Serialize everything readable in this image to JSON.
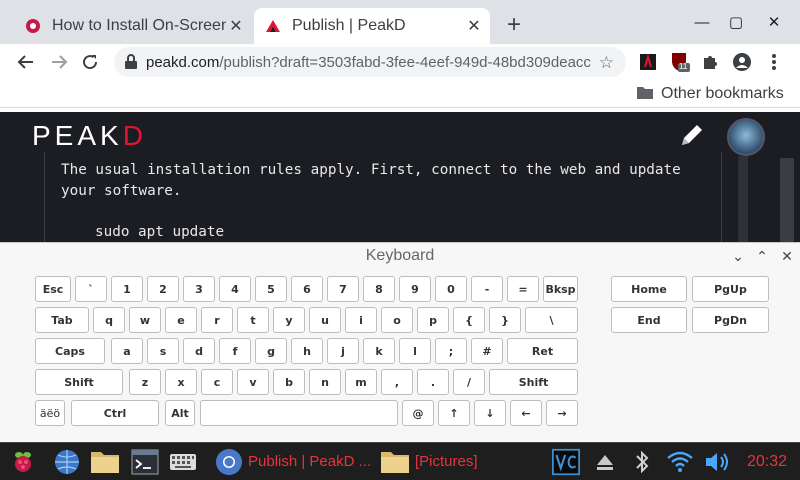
{
  "browser": {
    "tabs": [
      {
        "title": "How to Install On-Screen Keyboard",
        "active": false
      },
      {
        "title": "Publish | PeakD",
        "active": true
      }
    ],
    "new_tab_label": "+",
    "url_domain": "peakd.com",
    "url_path": "/publish?draft=3503fabd-3fee-4eef-949d-48bd309deacc",
    "bookmarks_folder": "Other bookmarks",
    "extension_badge": "11"
  },
  "page": {
    "logo_main": "PEAK",
    "logo_accent": "D",
    "editor_text": "The usual installation rules apply. First, connect to the web and update your software.",
    "editor_code": "sudo apt update"
  },
  "keyboard": {
    "title": "Keyboard",
    "rows": [
      [
        "Esc",
        "`",
        "1",
        "2",
        "3",
        "4",
        "5",
        "6",
        "7",
        "8",
        "9",
        "0",
        "-",
        "=",
        "Bksp"
      ],
      [
        "Tab",
        "q",
        "w",
        "e",
        "r",
        "t",
        "y",
        "u",
        "i",
        "o",
        "p",
        "{",
        "}",
        "\\"
      ],
      [
        "Caps",
        "a",
        "s",
        "d",
        "f",
        "g",
        "h",
        "j",
        "k",
        "l",
        ";",
        "#",
        "Ret"
      ],
      [
        "Shift",
        "z",
        "x",
        "c",
        "v",
        "b",
        "n",
        "m",
        ",",
        ".",
        "/",
        "Shift"
      ],
      [
        "äëö",
        "Ctrl",
        "Alt",
        "",
        "@",
        "↑",
        "↓",
        "←",
        "→"
      ]
    ],
    "nav_keys": [
      "Home",
      "PgUp",
      "End",
      "PgDn"
    ]
  },
  "taskbar": {
    "task1": "Publish | PeakD ...",
    "task2": "[Pictures]",
    "clock": "20:32"
  },
  "colors": {
    "accent": "#e31337",
    "taskbar_text": "#e8333c",
    "page_bg": "#1b1d22"
  }
}
